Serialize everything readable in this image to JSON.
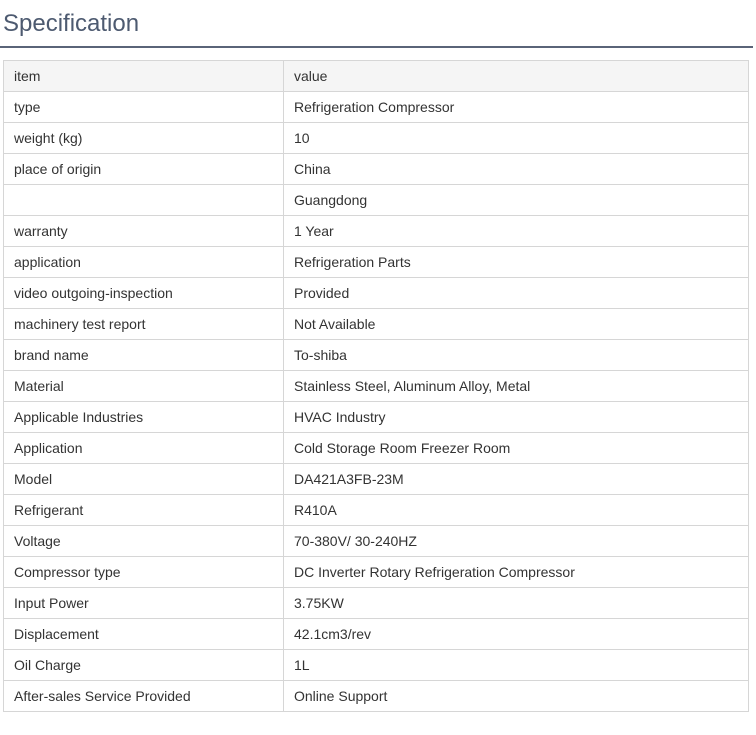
{
  "title": "Specification",
  "header": {
    "item": "item",
    "value": "value"
  },
  "rows": [
    {
      "item": "type",
      "value": "Refrigeration Compressor"
    },
    {
      "item": "weight (kg)",
      "value": "10"
    },
    {
      "item": "place of origin",
      "value": "China"
    },
    {
      "item": "",
      "value": "Guangdong"
    },
    {
      "item": "warranty",
      "value": "1 Year"
    },
    {
      "item": "application",
      "value": "Refrigeration Parts"
    },
    {
      "item": "video outgoing-inspection",
      "value": "Provided"
    },
    {
      "item": "machinery test report",
      "value": "Not Available"
    },
    {
      "item": "brand name",
      "value": "To-shiba"
    },
    {
      "item": "Material",
      "value": "Stainless Steel, Aluminum Alloy, Metal"
    },
    {
      "item": "Applicable Industries",
      "value": "HVAC Industry"
    },
    {
      "item": "Application",
      "value": "Cold Storage Room Freezer Room"
    },
    {
      "item": "Model",
      "value": "DA421A3FB-23M"
    },
    {
      "item": "Refrigerant",
      "value": "R410A"
    },
    {
      "item": "Voltage",
      "value": "70-380V/ 30-240HZ"
    },
    {
      "item": "Compressor type",
      "value": "DC Inverter Rotary Refrigeration Compressor"
    },
    {
      "item": "Input Power",
      "value": "3.75KW"
    },
    {
      "item": "Displacement",
      "value": "42.1cm3/rev"
    },
    {
      "item": "Oil Charge",
      "value": "1L"
    },
    {
      "item": "After-sales Service Provided",
      "value": "Online Support"
    }
  ]
}
